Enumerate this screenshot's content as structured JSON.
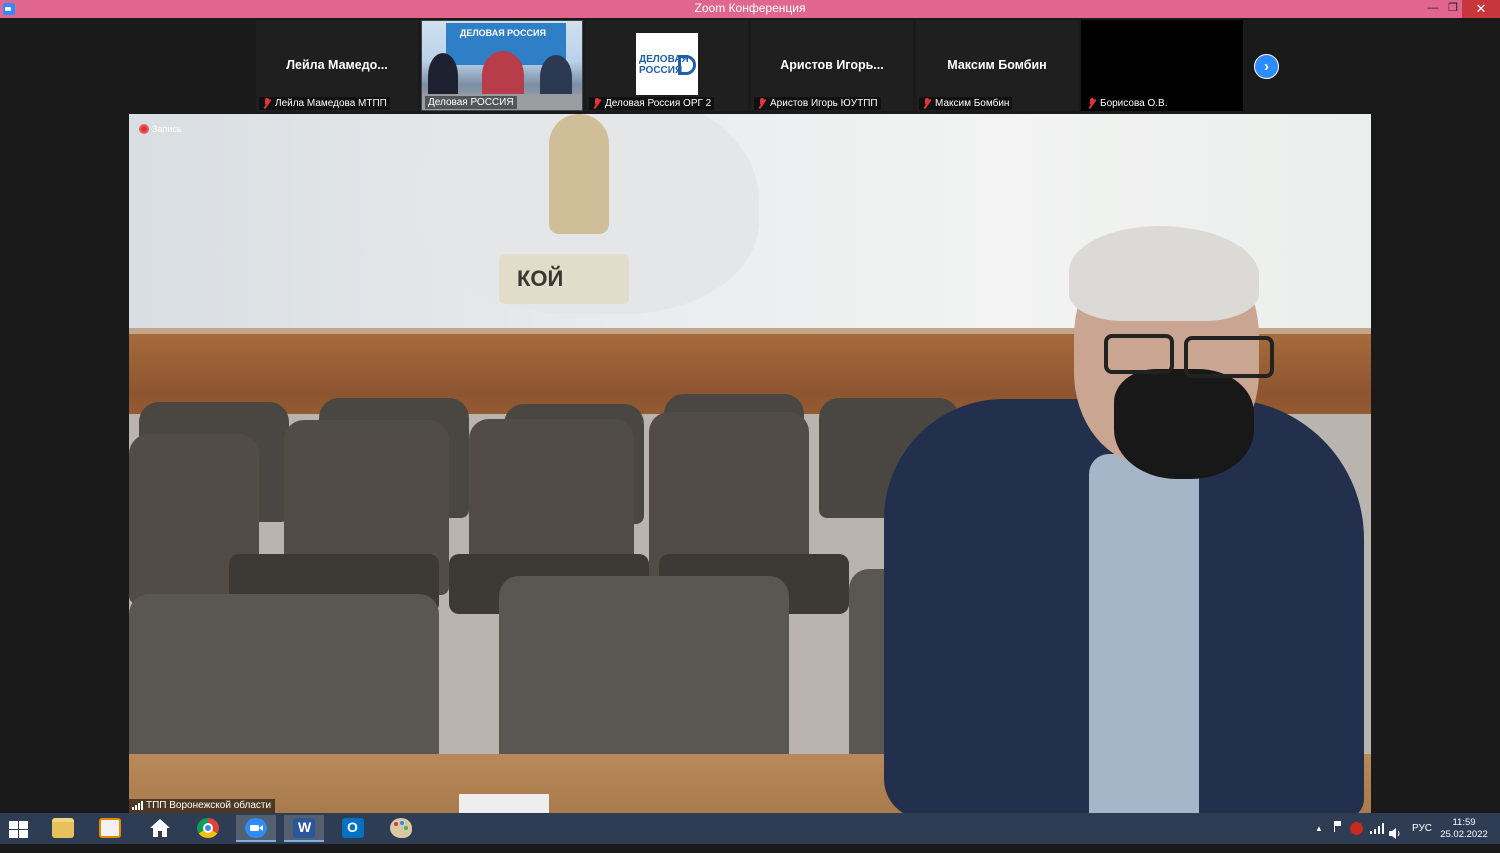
{
  "window": {
    "title": "Zoom Конференция",
    "minimize_glyph": "—",
    "maximize_glyph": "❐",
    "close_glyph": "✕"
  },
  "participants": [
    {
      "display": "Лейла  Мамедо...",
      "label": "Лейла Мамедова МТПП",
      "muted": true,
      "type": "name"
    },
    {
      "display": "",
      "label": "Деловая РОССИЯ",
      "muted": false,
      "type": "video"
    },
    {
      "display": "",
      "label": "Деловая Россия ОРГ 2",
      "muted": true,
      "type": "logo",
      "logo_line1": "ДЕЛОВАЯ",
      "logo_line2": "РОССИЯ"
    },
    {
      "display": "Аристов  Игорь...",
      "label": "Аристов Игорь ЮУТПП",
      "muted": true,
      "type": "name"
    },
    {
      "display": "Максим Бомбин",
      "label": "Максим Бомбин",
      "muted": true,
      "type": "name"
    },
    {
      "display": "",
      "label": "Борисова О.В.",
      "muted": true,
      "type": "black"
    }
  ],
  "video_banner_text": "ДЕЛОВАЯ РОССИЯ",
  "next_page_glyph": "›",
  "main": {
    "recording_label": "Запись",
    "speaker_label": "ТПП Воронежской области",
    "background_text": "КОЙ"
  },
  "taskbar": {
    "tray_lang": "РУС",
    "time": "11:59",
    "date": "25.02.2022",
    "tray_arrow": "▲"
  },
  "colors": {
    "titlebar": "#e0658f",
    "zoom_blue": "#2d8cff",
    "taskbar": "#2e3d54",
    "muted_red": "#e0343c"
  }
}
